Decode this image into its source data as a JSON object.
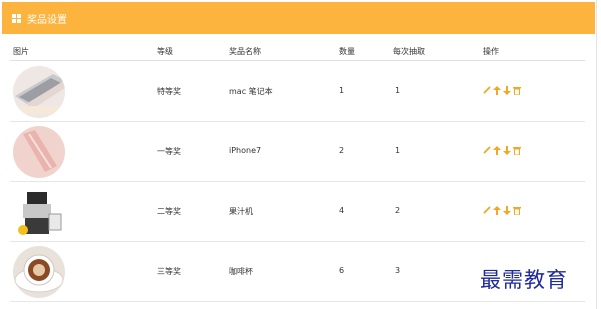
{
  "header": {
    "title": "奖品设置",
    "icon": "grid-icon",
    "color": "#fdb43f"
  },
  "columns": [
    "图片",
    "等级",
    "奖品名称",
    "数量",
    "每次抽取",
    "操作"
  ],
  "rows": [
    {
      "image": "laptop",
      "level": "特等奖",
      "name": "mac 笔记本",
      "quantity": "1",
      "per_draw": "1"
    },
    {
      "image": "phone",
      "level": "一等奖",
      "name": "iPhone7",
      "quantity": "2",
      "per_draw": "1"
    },
    {
      "image": "juicer",
      "level": "二等奖",
      "name": "果汁机",
      "quantity": "4",
      "per_draw": "2"
    },
    {
      "image": "coffee-cup",
      "level": "三等奖",
      "name": "咖啡杯",
      "quantity": "6",
      "per_draw": "3"
    }
  ],
  "actions": [
    "edit-icon",
    "move-up-icon",
    "move-down-icon",
    "delete-icon"
  ],
  "accent_color": "#f5a623",
  "watermark": "最需教育"
}
